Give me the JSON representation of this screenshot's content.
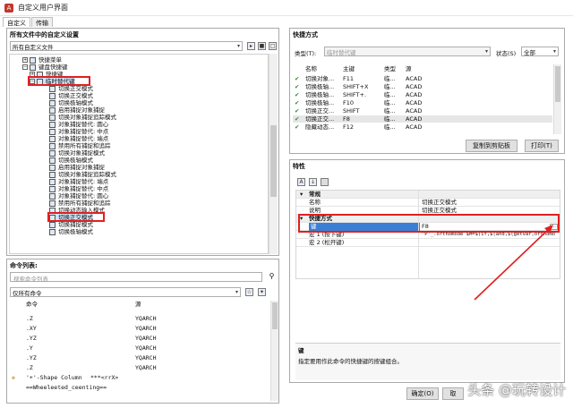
{
  "window": {
    "title": "自定义用户界面"
  },
  "tabs": [
    "自定义",
    "传输"
  ],
  "left_panel": {
    "heading": "所有文件中的自定义设置",
    "filter_select": "所有自定义文件",
    "tree": [
      "快捷菜单",
      "键盘快捷键",
      "快捷键",
      "临时替代键",
      "切换正交模式",
      "切换正交模式",
      "切换极轴模式",
      "启用捕捉对象捕捉",
      "切换对象捕捉追踪模式",
      "对象捕捉替代: 圆心",
      "对象捕捉替代: 中点",
      "对象捕捉替代: 端点",
      "禁用所有捕捉和追踪",
      "切换对象捕捉模式",
      "切换极轴模式",
      "启用捕捉对象捕捉",
      "切换对象捕捉追踪模式",
      "对象捕捉替代: 端点",
      "对象捕捉替代: 中点",
      "对象捕捉替代: 圆心",
      "禁用所有捕捉和追踪",
      "切换动态输入模式",
      "切换正交模式",
      "切换捕捉模式",
      "切换极轴模式"
    ]
  },
  "command_list": {
    "heading": "命令列表:",
    "search_placeholder": "搜索命令列表",
    "filter_select": "仅所有命令",
    "col_command": "命令",
    "col_source": "源",
    "rows": [
      {
        "cmd": ".Z",
        "src": "YQARCH"
      },
      {
        "cmd": ".XY",
        "src": "YQARCH"
      },
      {
        "cmd": ".YZ",
        "src": "YQARCH"
      },
      {
        "cmd": ".Y",
        "src": "YQARCH"
      },
      {
        "cmd": ".YZ",
        "src": "YQARCH"
      },
      {
        "cmd": ".Z",
        "src": "YQARCH"
      },
      {
        "cmd": "'+'-Shape Column",
        "src": "***<rrX>"
      },
      {
        "cmd": "==Wheeleeted_ceenting==",
        "src": ""
      }
    ]
  },
  "shortcuts": {
    "heading": "快捷方式",
    "type_label": "类型(T):",
    "type_value": "临时替代键",
    "status_label": "状态(S)",
    "status_value": "全部",
    "columns": [
      "名称",
      "主键",
      "类型",
      "源"
    ],
    "rows": [
      {
        "name": "切换对象...",
        "key": "F11",
        "type": "临...",
        "src": "ACAD"
      },
      {
        "name": "切换极轴...",
        "key": "SHIFT+X",
        "type": "临...",
        "src": "ACAD"
      },
      {
        "name": "切换极轴...",
        "key": "SHIFT+.",
        "type": "临...",
        "src": "ACAD"
      },
      {
        "name": "切换极轴...",
        "key": "F10",
        "type": "临...",
        "src": "ACAD"
      },
      {
        "name": "切换正交...",
        "key": "SHIFT",
        "type": "临...",
        "src": "ACAD"
      },
      {
        "name": "切换正交...",
        "key": "F8",
        "type": "临...",
        "src": "ACAD"
      },
      {
        "name": "隐藏动态...",
        "key": "F12",
        "type": "临...",
        "src": "ACAD"
      }
    ],
    "copy_button": "复制到剪贴板",
    "print_button": "打印(T)"
  },
  "properties": {
    "heading": "特性",
    "cat_general": "常规",
    "name_label": "名称",
    "name_value": "切换正交模式",
    "desc_label": "说明",
    "desc_value": "切换正交模式",
    "cat_shortcut": "快捷方式",
    "key_label": "键",
    "key_value": "F8",
    "macro1_label": "宏 1 (按下键)",
    "macro1_value": "^P'_.orthomode $M=$(if,$(and,$(getvar,orthomo",
    "macro2_label": "宏 2 (松开键)",
    "macro2_value": "",
    "desc_title": "键",
    "desc_text": "指定要用作此命令的快捷键的按键组合。"
  },
  "buttons": {
    "ok": "确定(O)",
    "cancel": "取"
  },
  "watermark": "头条 @玩转设计"
}
